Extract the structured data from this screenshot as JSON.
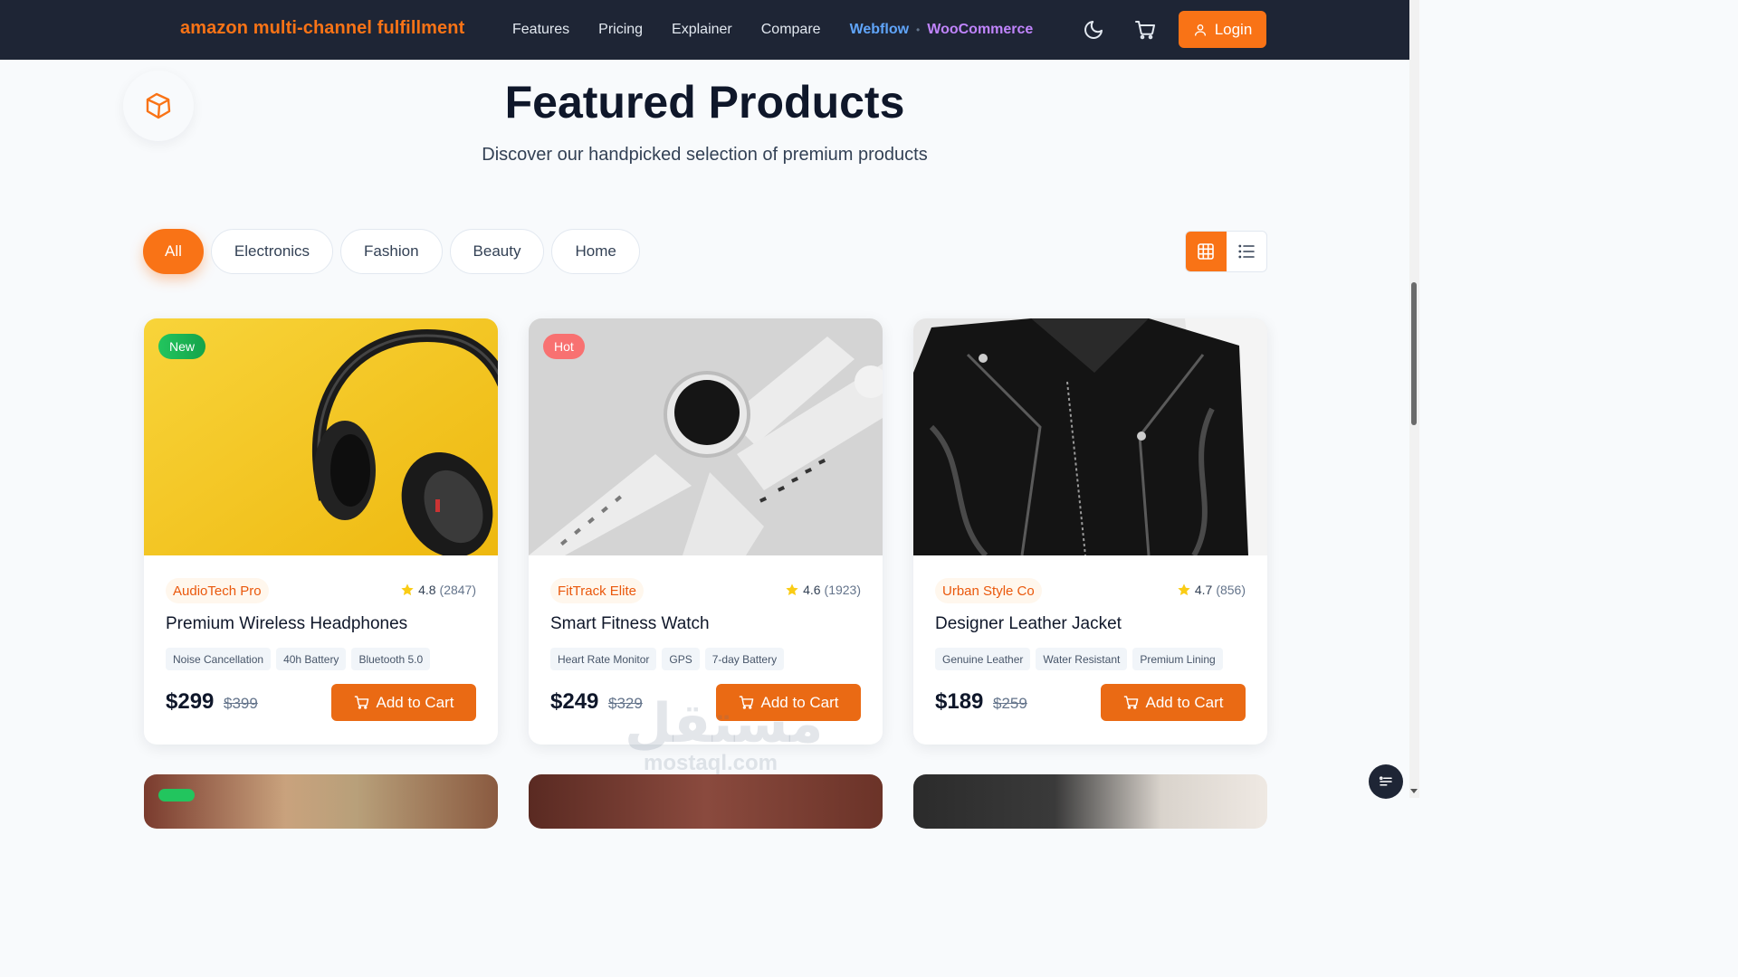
{
  "nav": {
    "brand": "amazon multi-channel fulfillment",
    "links": [
      "Features",
      "Pricing",
      "Explainer",
      "Compare"
    ],
    "webflow": "Webflow",
    "separator": "•",
    "woocommerce": "WooCommerce",
    "theme_icon": "moon-icon",
    "cart_icon": "cart-icon",
    "login_label": "Login",
    "login_icon": "user-icon"
  },
  "header": {
    "title": "Featured Products",
    "subtitle": "Discover our handpicked selection of premium products"
  },
  "filters": {
    "items": [
      "All",
      "Electronics",
      "Fashion",
      "Beauty",
      "Home"
    ],
    "active": "All"
  },
  "view_toggle": {
    "active": "grid",
    "icons": [
      "grid-icon",
      "list-icon"
    ]
  },
  "products": [
    {
      "badge": "New",
      "badge_color": "#22c55e",
      "brand": "AudioTech Pro",
      "rating": "4.8",
      "reviews": "(2847)",
      "name": "Premium Wireless Headphones",
      "features": [
        "Noise Cancellation",
        "40h Battery",
        "Bluetooth 5.0"
      ],
      "price": "$299",
      "old_price": "$399",
      "cta": "Add to Cart"
    },
    {
      "badge": "Hot",
      "badge_color": "#ef4444",
      "brand": "FitTrack Elite",
      "rating": "4.6",
      "reviews": "(1923)",
      "name": "Smart Fitness Watch",
      "features": [
        "Heart Rate Monitor",
        "GPS",
        "7-day Battery"
      ],
      "price": "$249",
      "old_price": "$329",
      "cta": "Add to Cart"
    },
    {
      "badge": "",
      "brand": "Urban Style Co",
      "rating": "4.7",
      "reviews": "(856)",
      "name": "Designer Leather Jacket",
      "features": [
        "Genuine Leather",
        "Water Resistant",
        "Premium Lining"
      ],
      "price": "$189",
      "old_price": "$259",
      "cta": "Add to Cart"
    }
  ],
  "watermark": {
    "arabic": "مستقل",
    "latin": "mostaql.com"
  },
  "colors": {
    "accent": "#f97316",
    "nav_bg": "#1e2535",
    "page_bg": "#f8fafc"
  }
}
